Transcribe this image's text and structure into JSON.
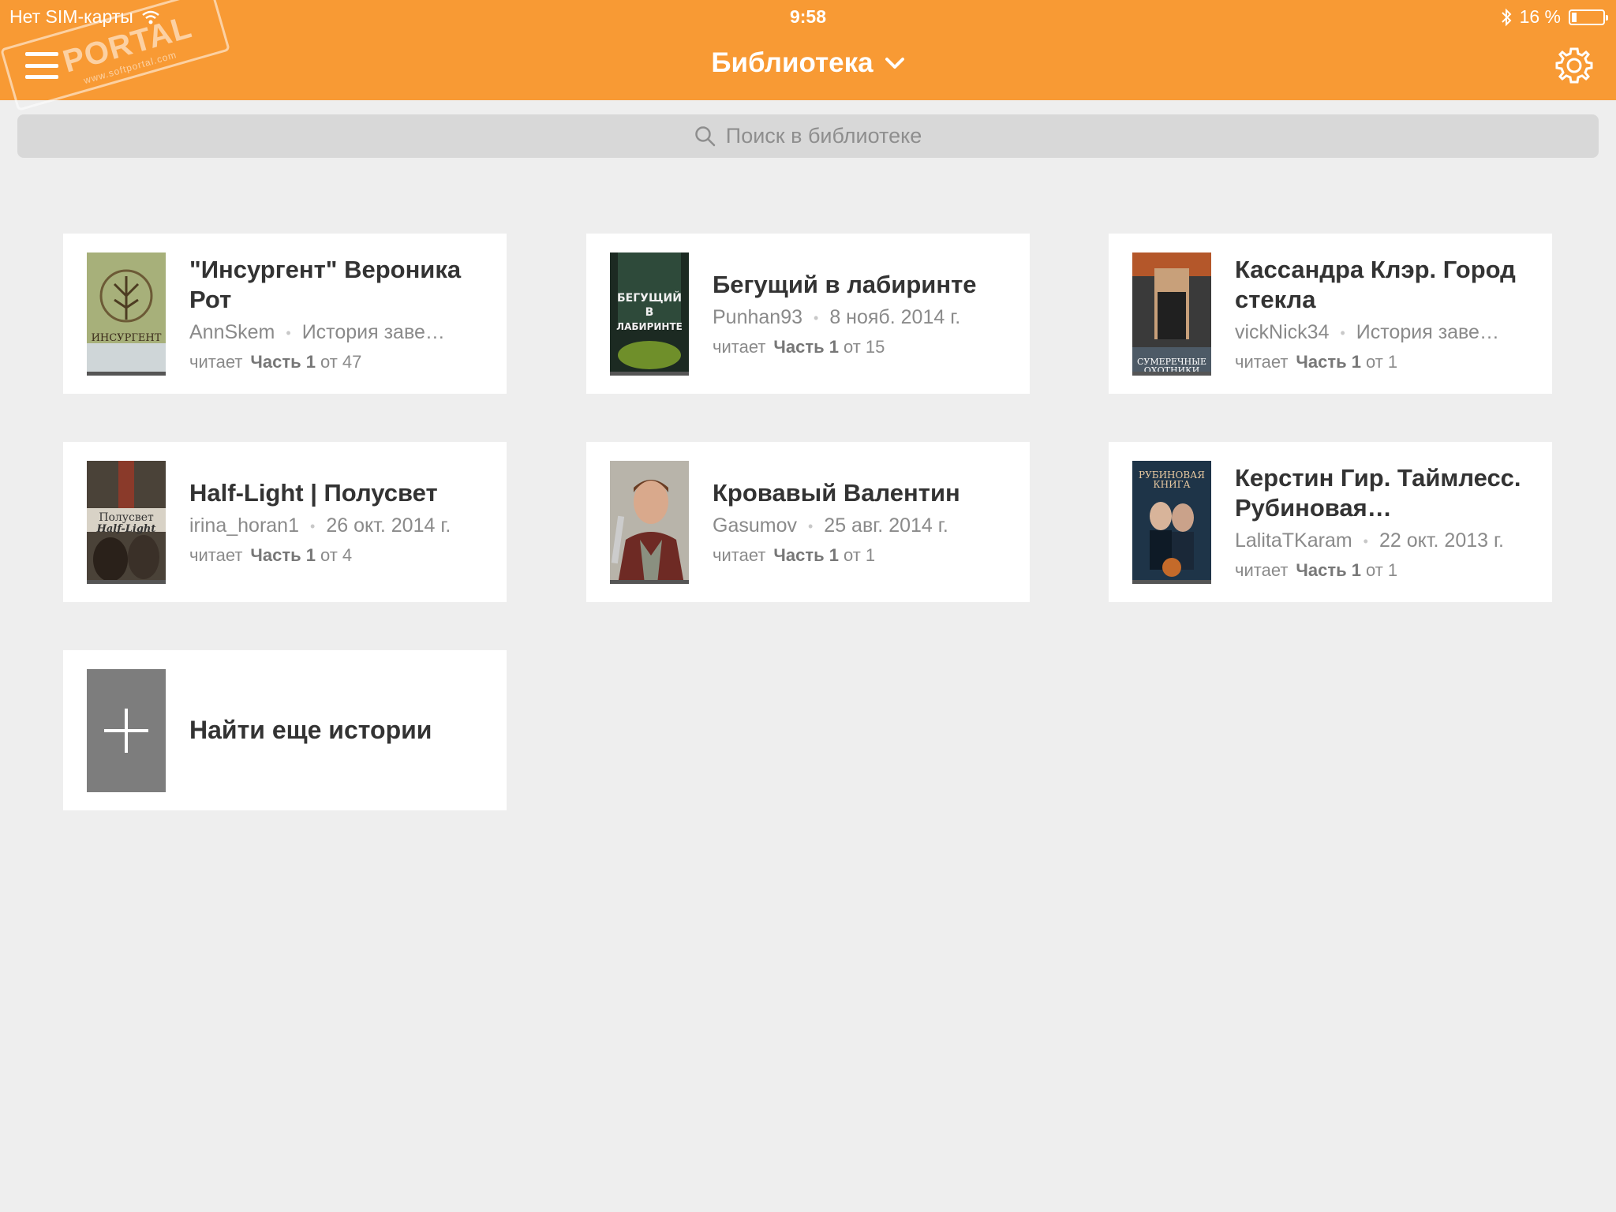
{
  "status_bar": {
    "carrier": "Нет SIM-карты",
    "time": "9:58",
    "battery": "16 %",
    "battery_level": 0.16
  },
  "watermark": {
    "brand": "PORTAL",
    "url": "www.softportal.com"
  },
  "header": {
    "title": "Библиотека",
    "background": "#f89a34"
  },
  "search": {
    "placeholder": "Поиск в библиотеке"
  },
  "books": [
    {
      "title": "\"Инсургент\" Вероника Рот",
      "author": "AnnSkem",
      "date": "История заве…",
      "reading_label": "читает",
      "part": "Часть 1",
      "of": "от 47",
      "cover_text": "ИНСУРГЕНТ"
    },
    {
      "title": "Бегущий в лабиринте",
      "author": "Punhan93",
      "date": "8 нояб. 2014 г.",
      "reading_label": "читает",
      "part": "Часть 1",
      "of": "от 15",
      "cover_text": "БЕГУЩИЙ В ЛАБИРИНТЕ"
    },
    {
      "title": "Кассандра Клэр. Город стекла",
      "author": "vickNick34",
      "date": "История заве…",
      "reading_label": "читает",
      "part": "Часть 1",
      "of": "от 1",
      "cover_text": "СУМЕРЕЧНЫЕ ОХОТНИКИ"
    },
    {
      "title": "Half-Light | Полусвет",
      "author": "irina_horan1",
      "date": "26 окт. 2014 г.",
      "reading_label": "читает",
      "part": "Часть 1",
      "of": "от 4",
      "cover_text": "Полусвет Half-Light"
    },
    {
      "title": "Кровавый Валентин",
      "author": "Gasumov",
      "date": "25 авг. 2014 г.",
      "reading_label": "читает",
      "part": "Часть 1",
      "of": "от 1",
      "cover_text": ""
    },
    {
      "title": "Керстин Гир. Таймлесс. Рубиновая…",
      "author": "LalitaTKaram",
      "date": "22 окт. 2013 г.",
      "reading_label": "читает",
      "part": "Часть 1",
      "of": "от 1",
      "cover_text": "РУБИНОВАЯ КНИГА"
    }
  ],
  "add_more": {
    "label": "Найти еще истории"
  }
}
